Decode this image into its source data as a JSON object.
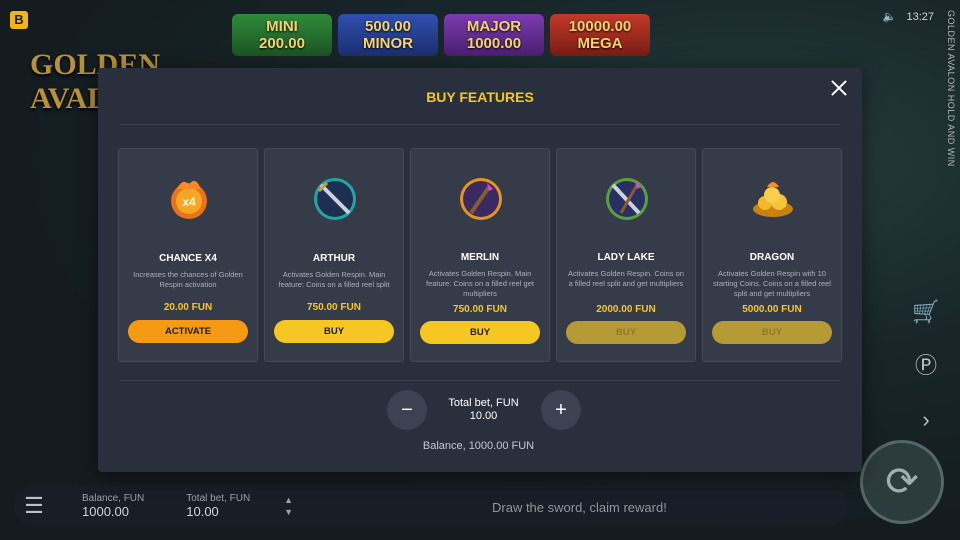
{
  "topbar": {
    "brand_letter": "B",
    "time": "13:27",
    "sound_icon": "speaker-icon",
    "vertical_title": "GOLDEN AVALON HOLD AND WIN"
  },
  "game_logo": "GOLDEN AVALON",
  "jackpots": [
    {
      "name": "MINI",
      "value": "200.00",
      "color": "#2f8a3a"
    },
    {
      "name": "MINOR",
      "value": "500.00",
      "color": "#2f4fb0"
    },
    {
      "name": "MAJOR",
      "value": "1000.00",
      "color": "#7b3bb0"
    },
    {
      "name": "MEGA",
      "value": "10000.00",
      "color": "#c23a2a"
    }
  ],
  "modal": {
    "title": "BUY FEATURES",
    "close_icon": "close-icon",
    "cards": [
      {
        "name": "CHANCE X4",
        "description": "Increases the chances of Golden Respin activation",
        "price": "20.00 FUN",
        "button": "ACTIVATE",
        "state": "active",
        "icon": "chance-x4-icon",
        "icon_text": "x4"
      },
      {
        "name": "ARTHUR",
        "description": "Activates Golden Respin. Main feature: Coins on a filled reel split",
        "price": "750.00 FUN",
        "button": "BUY",
        "state": "enabled",
        "icon": "arthur-sword-icon"
      },
      {
        "name": "MERLIN",
        "description": "Activates Golden Respin. Main feature: Coins on a filled reel get multipliers",
        "price": "750.00 FUN",
        "button": "BUY",
        "state": "enabled",
        "icon": "merlin-staff-icon"
      },
      {
        "name": "LADY LAKE",
        "description": "Activates Golden Respin. Coins on a filled reel split and get multipliers",
        "price": "2000.00 FUN",
        "button": "BUY",
        "state": "disabled",
        "icon": "lady-lake-icon"
      },
      {
        "name": "DRAGON",
        "description": "Activates Golden Respin with 10 starting Coins. Coins on a filled reel split and get multipliers",
        "price": "5000.00 FUN",
        "button": "BUY",
        "state": "disabled",
        "icon": "dragon-gold-icon"
      }
    ],
    "total_bet_label": "Total bet, FUN",
    "total_bet_value": "10.00",
    "minus_label": "−",
    "plus_label": "+",
    "balance_label": "Balance,",
    "balance_value": "1000.00 FUN"
  },
  "bottom_bar": {
    "balance_label": "Balance, FUN",
    "balance_value": "1000.00",
    "total_bet_label": "Total bet, FUN",
    "total_bet_value": "10.00",
    "message": "Draw the sword, claim reward!"
  },
  "colors": {
    "accent": "#f6c623",
    "activate": "#f59a12",
    "modal_bg": "#2a2f3d",
    "card_bg": "#363b4a"
  }
}
